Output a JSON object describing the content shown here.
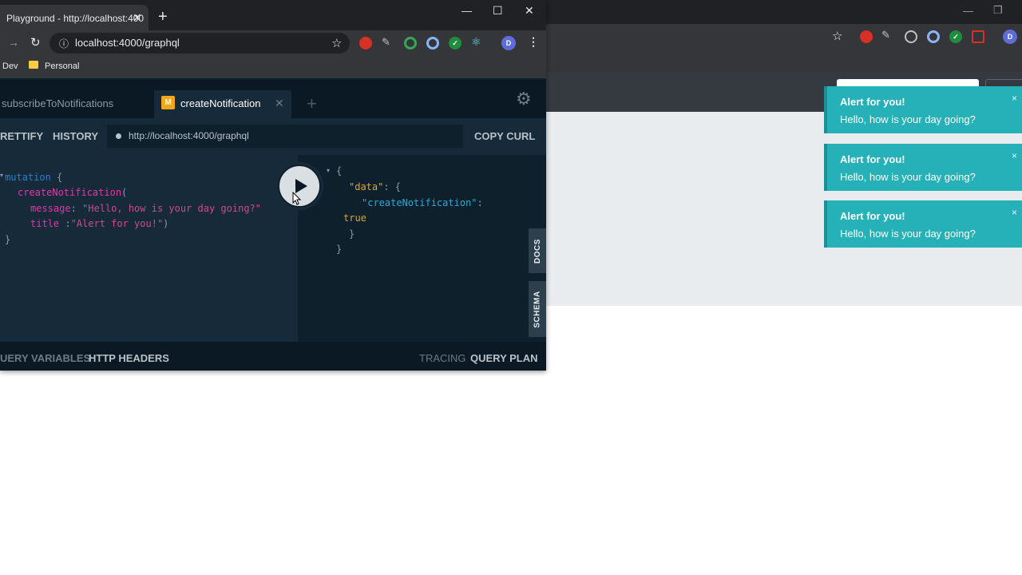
{
  "foreground_window": {
    "tab_title": "Playground - http://localhost:400",
    "url": "localhost:4000/graphql",
    "bookmarks": [
      "Dev",
      "Personal"
    ],
    "avatar_letter": "D"
  },
  "playground": {
    "tabs": [
      {
        "label": "subscribeToNotifications"
      },
      {
        "label": "createNotification",
        "badge": "M"
      }
    ],
    "toolbar": {
      "prettify": "RETTIFY",
      "history": "HISTORY",
      "endpoint": "http://localhost:4000/graphql",
      "copy_curl": "COPY CURL"
    },
    "query": {
      "l1_kw": "mutation",
      "l1_p": " {",
      "l2_fn": "createNotification",
      "l2_p": "(",
      "l3_arg": "message",
      "l3_p": ": ",
      "l3_str": "\"Hello, how is your day going?\"",
      "l4_arg": "title",
      "l4_p": " :",
      "l4_str": "\"Alert for you!\"",
      "l4_end": ")",
      "l5": "}"
    },
    "result": {
      "l1": "{",
      "l2_key": "\"data\"",
      "l2_p": ": {",
      "l3_key": "\"createNotification\"",
      "l3_p": ":",
      "l4": "true",
      "l5": "}",
      "l6": "}"
    },
    "side_tabs": {
      "docs": "DOCS",
      "schema": "SCHEMA"
    },
    "bottom": {
      "query_variables": "UERY VARIABLES",
      "http_headers": "HTTP HEADERS",
      "tracing": "TRACING",
      "query_plan": "QUERY PLAN"
    }
  },
  "background_window": {
    "avatar_letter": "D"
  },
  "toasts": [
    {
      "title": "Alert for you!",
      "message": "Hello, how is your day going?",
      "close": "×"
    },
    {
      "title": "Alert for you!",
      "message": "Hello, how is your day going?",
      "close": "×"
    },
    {
      "title": "Alert for you!",
      "message": "Hello, how is your day going?",
      "close": "×"
    }
  ],
  "colors": {
    "toast_bg": "#26b0b8",
    "playground_bg": "#0f202d",
    "mutation_badge": "#f2a71b"
  }
}
